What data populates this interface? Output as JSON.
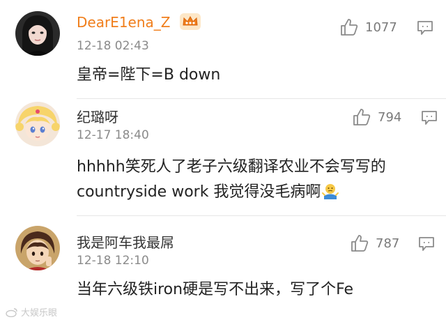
{
  "comments": [
    {
      "user": "DearE1ena_Z",
      "time": "12-18 02:43",
      "text": "皇帝=陛下=B down",
      "likes": "1077"
    },
    {
      "user": "纪璐呀",
      "time": "12-17 18:40",
      "text_line1": "hhhhh笑死人了老子六级翻译农业不会写写的",
      "text_line2": "countryside work 我觉得没毛病啊",
      "likes": "794"
    },
    {
      "user": "我是阿车我最屌",
      "time": "12-18 12:10",
      "text": "当年六级铁iron硬是写不出来，写了个Fe",
      "likes": "787"
    }
  ],
  "watermark": "大娱乐眼",
  "colors": {
    "vip_name": "#f07e1b",
    "name": "#333333",
    "time": "#8a8a8a",
    "text": "#222222",
    "icon": "#8a8a8a"
  },
  "icons": [
    "thumbs-up-icon",
    "comment-icon",
    "crown-vip-icon",
    "shrug-emoji"
  ]
}
